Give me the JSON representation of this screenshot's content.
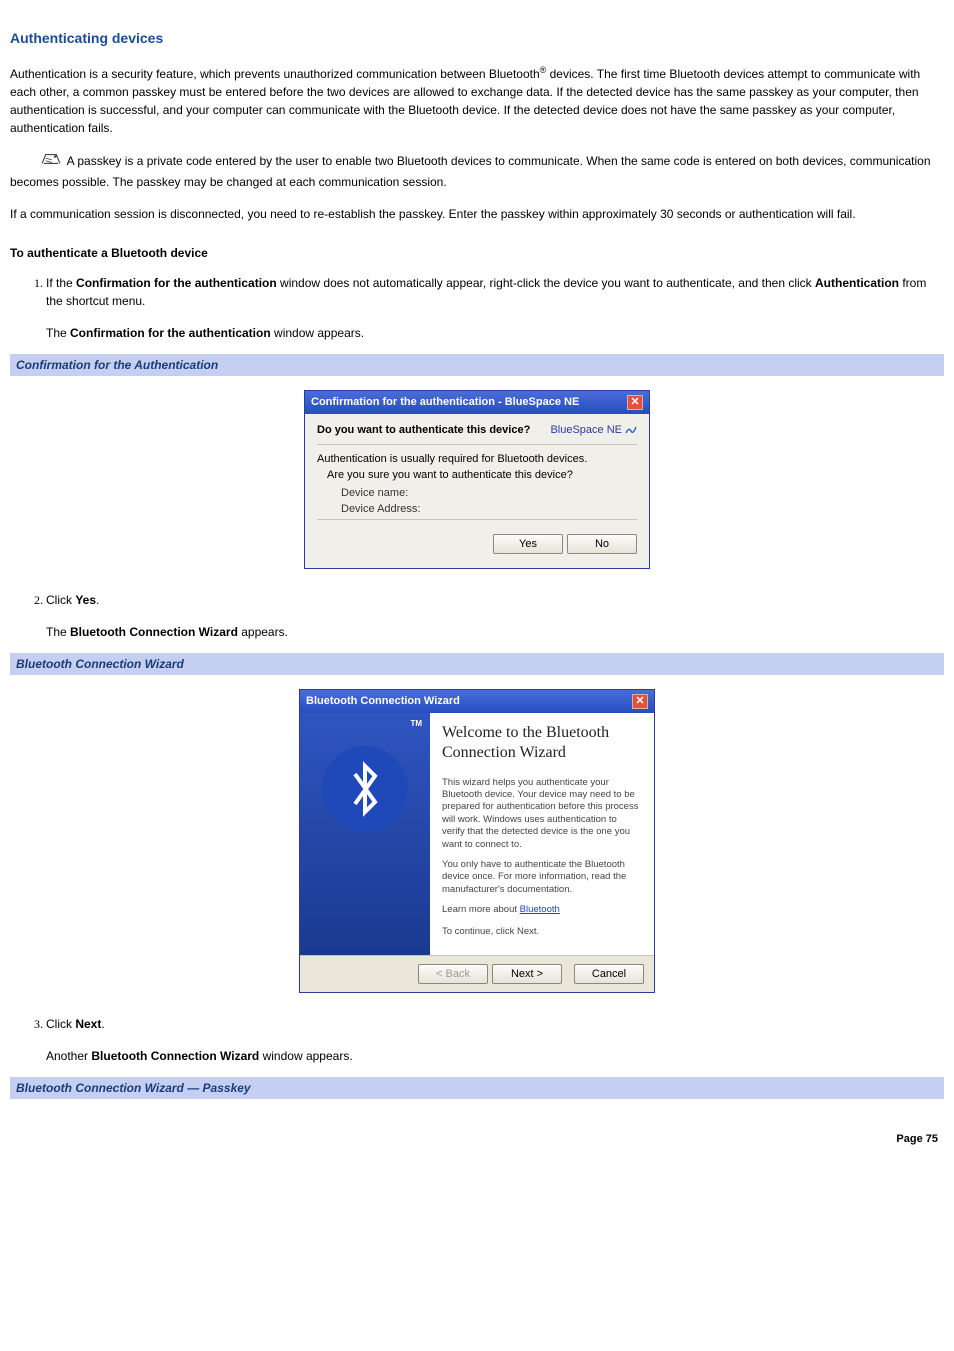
{
  "heading": "Authenticating devices",
  "intro_a": "Authentication is a security feature, which prevents unauthorized communication between Bluetooth",
  "intro_sup": "®",
  "intro_b": " devices. The first time Bluetooth devices attempt to communicate with each other, a common passkey must be entered before the two devices are allowed to exchange data. If the detected device has the same passkey as your computer, then authentication is successful, and your computer can communicate with the Bluetooth device. If the detected device does not have the same passkey as your computer, authentication fails.",
  "note1": " A passkey is a private code entered by the user to enable two Bluetooth devices to communicate. When the same code is entered on both devices, communication becomes possible. The passkey may be changed at each communication session.",
  "note2": "If a communication session is disconnected, you need to re-establish the passkey. Enter the passkey within approximately 30 seconds or authentication will fail.",
  "sub_heading": "To authenticate a Bluetooth device",
  "steps": {
    "s1_a": "If the ",
    "s1_b1": "Confirmation for the authentication",
    "s1_c": " window does not automatically appear, right-click the device you want to authenticate, and then click ",
    "s1_b2": "Authentication",
    "s1_d": " from the shortcut menu.",
    "s1_sub_a": "The ",
    "s1_sub_b": "Confirmation for the authentication",
    "s1_sub_c": " window appears.",
    "s2_a": "Click ",
    "s2_b": "Yes",
    "s2_c": ".",
    "s2_sub_a": "The ",
    "s2_sub_b": "Bluetooth Connection Wizard",
    "s2_sub_c": " appears.",
    "s3_a": "Click ",
    "s3_b": "Next",
    "s3_c": ".",
    "s3_sub_a": "Another ",
    "s3_sub_b": "Bluetooth Connection Wizard",
    "s3_sub_c": " window appears."
  },
  "banner1": "Confirmation for the Authentication",
  "banner2": "Bluetooth Connection Wizard",
  "banner3": "Bluetooth Connection Wizard — Passkey",
  "dlg1": {
    "title": "Confirmation for the authentication - BlueSpace NE",
    "prompt": "Do you want to authenticate this device?",
    "brand": "BlueSpace NE",
    "info": "Authentication is usually required for Bluetooth devices.",
    "q2": "Are you sure you want to authenticate this device?",
    "dev_name": "Device name:",
    "dev_addr": "Device Address:",
    "yes": "Yes",
    "no": "No"
  },
  "dlg2": {
    "title": "Bluetooth Connection Wizard",
    "tm": "TM",
    "welcome": "Welcome to the Bluetooth Connection Wizard",
    "p1": "This wizard helps you authenticate your Bluetooth device. Your device may need to be prepared for authentication before this process will work. Windows uses authentication to verify that the detected device is the one you want to connect to.",
    "p2": "You only have to authenticate the Bluetooth device once. For more information, read the manufacturer's documentation.",
    "learn_a": "Learn more about ",
    "learn_link": "Bluetooth",
    "cont": "To continue, click Next.",
    "back": "< Back",
    "next": "Next >",
    "cancel": "Cancel"
  },
  "page_num": "Page 75"
}
